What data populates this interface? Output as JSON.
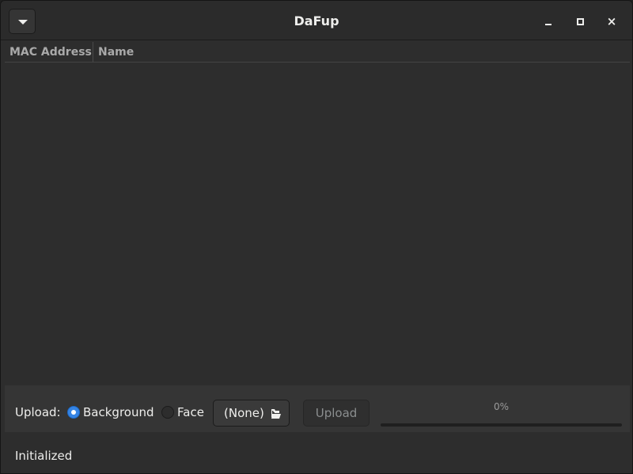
{
  "window": {
    "title": "DaFup"
  },
  "headerbar": {
    "menu_icon": "pan-down-icon",
    "minimize_icon": "window-minimize-icon",
    "maximize_icon": "window-maximize-icon",
    "close_icon": "window-close-icon",
    "close_glyph": "×"
  },
  "device_list": {
    "columns": [
      "MAC Address",
      "Name"
    ],
    "rows": []
  },
  "upload_controls": {
    "label": "Upload:",
    "options": [
      {
        "label": "Background",
        "selected": true
      },
      {
        "label": "Face",
        "selected": false
      }
    ],
    "file_chooser": {
      "label": "(None)",
      "icon": "document-open-icon"
    },
    "upload_button": {
      "label": "Upload",
      "enabled": false
    },
    "progress": {
      "text": "0%",
      "fraction": 0
    }
  },
  "status": {
    "text": "Initialized"
  },
  "colors": {
    "accent": "#3584e4",
    "window_bg": "#2d2d2d",
    "header_bg": "#2b2b2b"
  }
}
